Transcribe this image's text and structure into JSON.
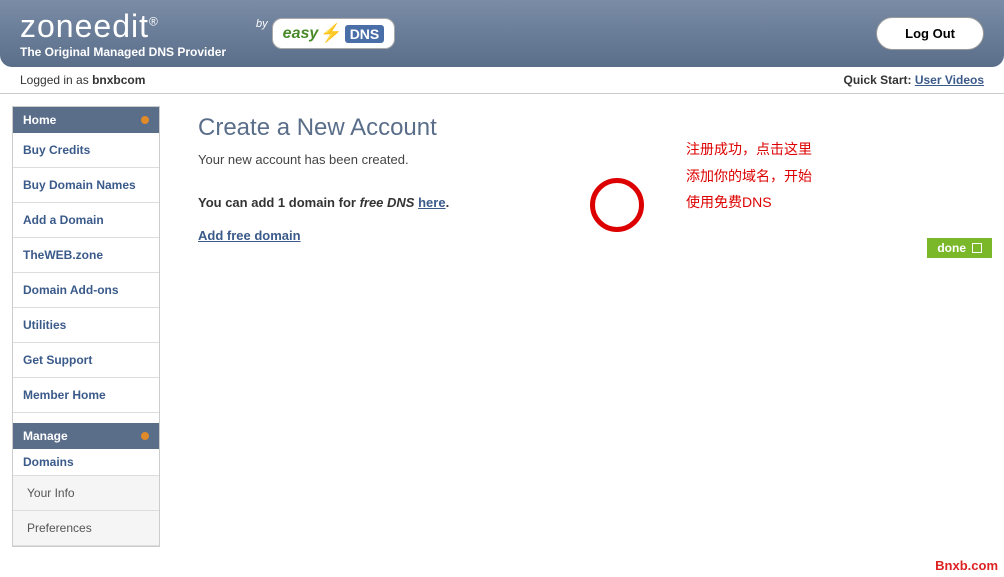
{
  "header": {
    "logo_main": "zone",
    "logo_edit": "edit",
    "logo_reg": "®",
    "logo_tag": "The Original Managed DNS Provider",
    "easydns_by": "by",
    "easydns_easy": "easy",
    "easydns_dns": "DNS",
    "logout": "Log Out"
  },
  "topbar": {
    "loggedin_prefix": "Logged in as ",
    "username": "bnxbcom",
    "qs_label": "Quick Start: ",
    "qs_link": "User Videos"
  },
  "sidebar": {
    "home_head": "Home",
    "home_items": [
      "Buy Credits",
      "Buy Domain Names",
      "Add a Domain",
      "TheWEB.zone",
      "Domain Add-ons",
      "Utilities",
      "Get Support",
      "Member Home"
    ],
    "manage_head": "Manage",
    "manage_sub": "Domains",
    "manage_items": [
      "Your Info",
      "Preferences"
    ]
  },
  "main": {
    "title": "Create a New Account",
    "created_msg": "Your new account has been created.",
    "add_prefix": "You can add 1 domain for ",
    "add_italic": "free DNS",
    "add_space": " ",
    "here": "here",
    "add_suffix": ".",
    "free_link": "Add free domain",
    "done": "done"
  },
  "annotation": {
    "line1": "注册成功，点击这里",
    "line2": "添加你的域名，开始",
    "line3": "使用免费DNS"
  },
  "watermark": "Bnxb.com"
}
